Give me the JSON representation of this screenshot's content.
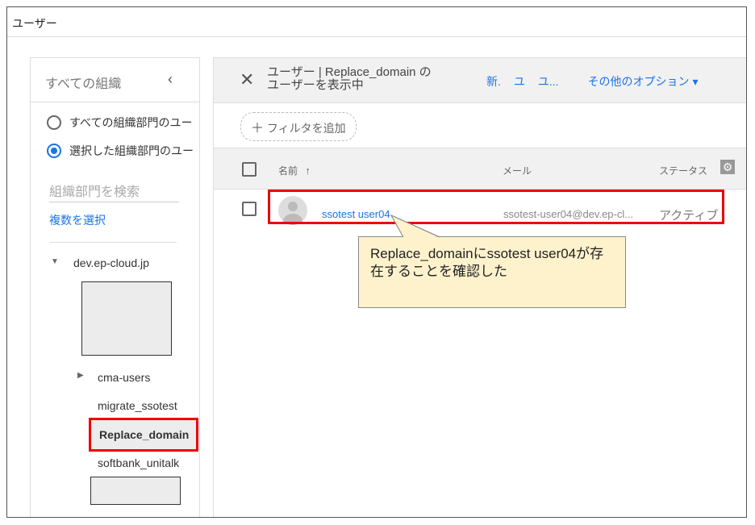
{
  "window": {
    "title": "ユーザー"
  },
  "sidebar": {
    "title": "すべての組織",
    "collapse_icon": "‹",
    "radio_all": "すべての組織部門のユー",
    "radio_selected": "選択した組織部門のユー",
    "search_placeholder": "組織部門を検索",
    "multi_select": "複数を選択",
    "root": "dev.ep-cloud.jp",
    "items": [
      "cma-users",
      "migrate_ssotest",
      "Replace_domain",
      "softbank_unitalk"
    ]
  },
  "header": {
    "title_line1": "ユーザー | Replace_domain の",
    "title_line2": "ユーザーを表示中",
    "actions": [
      "新.",
      "ユ",
      "ユ..."
    ],
    "more_options": "その他のオプション ▾"
  },
  "filter": {
    "label": "フィルタを追加"
  },
  "table": {
    "columns": {
      "name": "名前",
      "mail": "メール",
      "status": "ステータス"
    },
    "rows": [
      {
        "name": "ssotest user04",
        "email": "ssotest-user04@dev.ep-cl...",
        "status": "アクティブ"
      }
    ]
  },
  "annotation": {
    "text": "Replace_domainにssotest user04が存在することを確認した"
  },
  "colors": {
    "accent": "#1a73e8",
    "highlight": "#e00000",
    "callout": "#fdf2cc"
  }
}
